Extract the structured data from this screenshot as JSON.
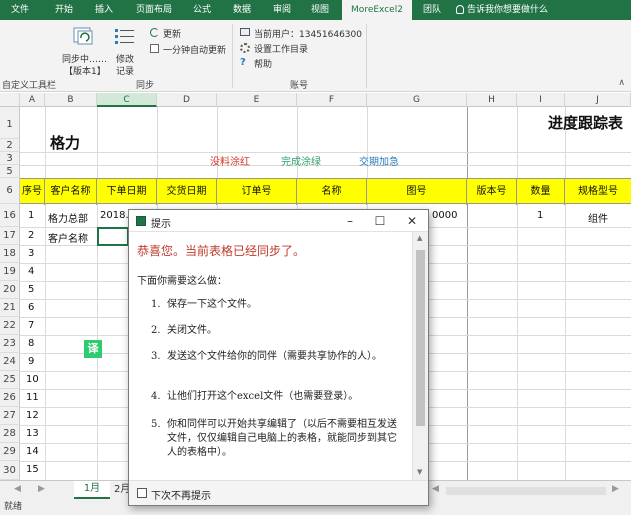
{
  "ribbon_tabs": [
    "文件",
    "开始",
    "插入",
    "页面布局",
    "公式",
    "数据",
    "审阅",
    "视图",
    "MoreExcel2",
    "团队"
  ],
  "tell_me": "告诉我你想要做什么",
  "ribbon": {
    "sync_label_1": "同步中……",
    "sync_label_2": "【版本1】",
    "history_label_1": "修改",
    "history_label_2": "记录",
    "update": "更新",
    "auto_update": "一分钟自动更新",
    "current_user": "当前用户：13451646300",
    "set_workdir": "设置工作目录",
    "help": "帮助",
    "group_custom": "自定义工具栏",
    "group_sync": "同步",
    "group_account": "账号"
  },
  "columns": [
    "A",
    "B",
    "C",
    "D",
    "E",
    "F",
    "G",
    "H",
    "I",
    "J"
  ],
  "sheet": {
    "company": "格力",
    "title": "进度跟踪表",
    "legend_red": "没料涂红",
    "legend_green": "完成涂绿",
    "legend_blue": "交期加急",
    "headers": [
      "序号",
      "客户名称",
      "下单日期",
      "交货日期",
      "订单号",
      "名称",
      "图号",
      "版本号",
      "数量",
      "规格型号"
    ],
    "row16": {
      "seq": "1",
      "customer": "格力总部",
      "order_date": "2018.",
      "drawing": "0000",
      "qty": "1",
      "spec": "组件"
    },
    "row17": {
      "seq": "2",
      "customer": "客户名称"
    },
    "row_numbers": [
      "1",
      "2",
      "3",
      "5",
      "6",
      "16",
      "17",
      "18",
      "19",
      "20",
      "21",
      "22",
      "23",
      "24",
      "25",
      "26",
      "27",
      "28",
      "29",
      "30"
    ],
    "seq_numbers": [
      "3",
      "4",
      "5",
      "6",
      "7",
      "8",
      "9",
      "10",
      "11",
      "12",
      "13",
      "14",
      "15"
    ],
    "translate_badge": "译"
  },
  "sheet_tabs": {
    "active": "1月",
    "next": "2月"
  },
  "status": "就绪",
  "dialog": {
    "title": "提示",
    "headline": "恭喜您。当前表格已经同步了。",
    "intro": "下面你需要这么做：",
    "steps": [
      {
        "num": "1.",
        "text": "保存一下这个文件。"
      },
      {
        "num": "2.",
        "text": "关闭文件。"
      },
      {
        "num": "3.",
        "text": "发送这个文件给你的同伴（需要共享协作的人）。"
      },
      {
        "num": "4.",
        "text": "让他们打开这个excel文件（也需要登录）。"
      },
      {
        "num": "5.",
        "text": "你和同伴可以开始共享编辑了（以后不需要相互发送文件，仅仅编辑自己电脑上的表格，就能同步到其它人的表格中）。"
      }
    ],
    "dont_show": "下次不再提示"
  },
  "colors": {
    "excel_green": "#217346",
    "header_yellow": "#ffff00",
    "headline_red": "#c0392b",
    "legend_red": "#d9342b",
    "legend_green": "#2e9d6a",
    "legend_blue": "#2b7ab8"
  }
}
